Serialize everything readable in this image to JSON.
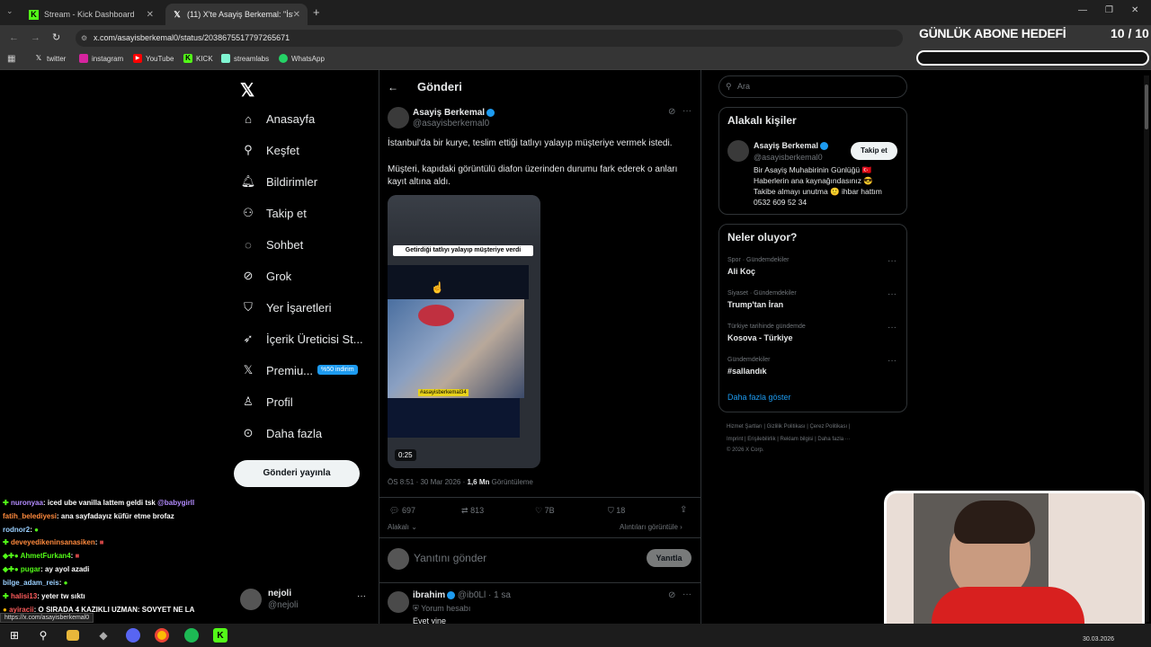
{
  "browser": {
    "tabs": [
      {
        "label": "Stream - Kick Dashboard",
        "icon": "kick-icon"
      },
      {
        "label": "(11) X'te Asayiş Berkemal: \"İstan",
        "icon": "x-icon"
      }
    ],
    "url": "x.com/asayisberkemal0/status/2038675517797265671",
    "bookmarks": [
      "twitter",
      "instagram",
      "YouTube",
      "KICK",
      "streamlabs",
      "WhatsApp"
    ]
  },
  "overlay": {
    "goal_title": "GÜNLÜK ABONE HEDEFİ",
    "goal_count": "10 / 10"
  },
  "sidebar": {
    "items": [
      {
        "label": "Anasayfa",
        "icon": "home-icon"
      },
      {
        "label": "Keşfet",
        "icon": "search-icon"
      },
      {
        "label": "Bildirimler",
        "icon": "bell-icon"
      },
      {
        "label": "Takip et",
        "icon": "follow-icon"
      },
      {
        "label": "Sohbet",
        "icon": "chat-icon"
      },
      {
        "label": "Grok",
        "icon": "grok-icon"
      },
      {
        "label": "Yer İşaretleri",
        "icon": "bookmark-icon"
      },
      {
        "label": "İçerik Üreticisi St...",
        "icon": "rocket-icon"
      },
      {
        "label": "Premiu...",
        "icon": "x-premium-icon"
      },
      {
        "label": "Profil",
        "icon": "person-icon"
      },
      {
        "label": "Daha fazla",
        "icon": "more-icon"
      }
    ],
    "premium_badge": "%50 indirim",
    "post_button": "Gönderi yayınla",
    "account": {
      "name": "nejoli",
      "handle": "@nejoli"
    }
  },
  "post": {
    "header": "Gönderi",
    "author": "Asayiş Berkemal",
    "handle": "@asayisberkemal0",
    "text1": "İstanbul'da bir kurye, teslim ettiği tatlıyı yalayıp müşteriye vermek istedi.",
    "text2a": "Müşteri, kapıdaki görüntülü diafon üzerinden durumu fark ederek o anları",
    "text2b": "kayıt altına aldı.",
    "video_caption": "Getirdiği tatlıyı yalayıp müşteriye verdi",
    "video_tag": "#asayisberkemal34",
    "video_duration": "0:25",
    "meta_time": "ÖS 8:51 · 30 Mar 2026 · ",
    "views": "1,6 Mn",
    "views_label": " Görüntüleme",
    "replies": "697",
    "reposts": "813",
    "likes": "7B",
    "bookmarks": "18",
    "relevant": "Alakalı",
    "quotes": "Alıntıları görüntüle",
    "reply_placeholder": "Yanıtını gönder",
    "reply_button": "Yanıtla"
  },
  "reply": {
    "author": "ibrahim",
    "handle": "@ib0Ll",
    "time": "· 1 sa",
    "badge": "Yorum hesabı",
    "text": "Evet yine"
  },
  "right": {
    "search_placeholder": "Ara",
    "relevant_title": "Alakalı kişiler",
    "person": {
      "name": "Asayiş Berkemal",
      "handle": "@asayisberkemal0",
      "follow": "Takip et",
      "bio1": "Bir Asayiş Muhabirinin Günlüğü 🇹🇷",
      "bio2": "Haberlerin ana kaynağındasınız 😎",
      "bio3": "Takibe almayı unutma 🙂 ihbar hattım",
      "bio4": "0532 609 52 34"
    },
    "trends_title": "Neler oluyor?",
    "trends": [
      {
        "context": "Spor · Gündemdekiler",
        "name": "Ali Koç"
      },
      {
        "context": "Siyaset · Gündemdekiler",
        "name": "Trump'tan İran"
      },
      {
        "context": "Türkiye tarihinde gündemde",
        "name": "Kosova - Türkiye"
      },
      {
        "context": "Gündemdekiler",
        "name": "#sallandık"
      }
    ],
    "show_more": "Daha fazla göster",
    "footer1": "Hizmet Şartları  |  Gizlilik Politikası  |  Çerez Politikası  |",
    "footer2": "Imprint  |  Erişilebilirlik  |  Reklam bilgisi  |  Daha fazla ···",
    "footer3": "© 2026 X Corp."
  },
  "chat": [
    {
      "user": "nuronyaa",
      "msg": ": iced ube vanilla lattem geldi tsk ",
      "extra": "@babygirll",
      "color": "#b48cff"
    },
    {
      "user": "fatih_belediyesi",
      "msg": ": ana sayfadayız küfür etme brofaz",
      "extra": "",
      "color": "#ff8a3d"
    },
    {
      "user": "rodnor2",
      "msg": ": ",
      "extra": "",
      "color": "#9ad0ff"
    },
    {
      "user": "deveyedikeninsanasiken",
      "msg": ": ",
      "extra": "",
      "color": "#ff8a3d"
    },
    {
      "user": "AhmetFurkan4",
      "msg": ": ",
      "extra": "",
      "color": "#53fc18"
    },
    {
      "user": "pugar",
      "msg": ": ay ayol azadi",
      "extra": "",
      "color": "#53fc18"
    },
    {
      "user": "bilge_adam_reis",
      "msg": ": ",
      "extra": "",
      "color": "#9ad0ff"
    },
    {
      "user": "halisi13",
      "msg": ": yeter tw sıktı",
      "extra": "",
      "color": "#ff5c5c"
    },
    {
      "user": "ayiracii",
      "msg": ": O SIRADA 4 KAZIKLI UZMAN: SOVYET NE LA",
      "extra": "",
      "color": "#ff5c5c"
    }
  ],
  "status_url": "https://x.com/asayisberkemal0",
  "taskbar": {
    "date": "30.03.2026"
  }
}
